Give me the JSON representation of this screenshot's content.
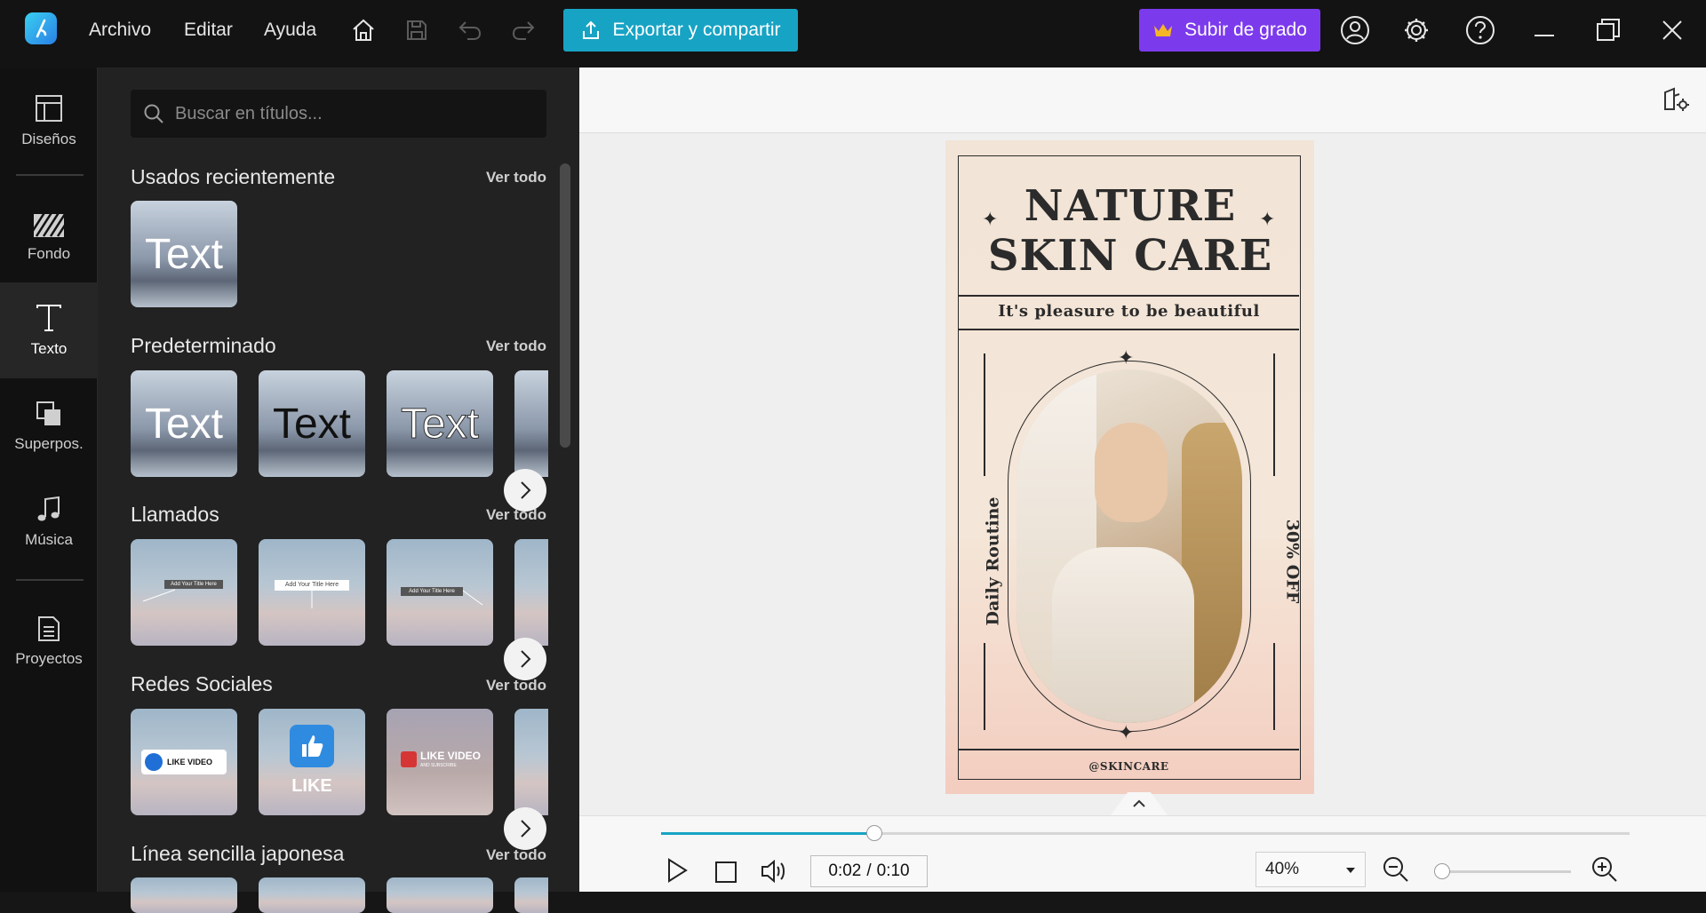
{
  "menu": [
    "Archivo",
    "Editar",
    "Ayuda"
  ],
  "toolbar": {
    "export_label": "Exportar y compartir",
    "upgrade_label": "Subir de grado"
  },
  "nav": [
    {
      "label": "Diseños",
      "icon": "layout-icon"
    },
    {
      "label": "Fondo",
      "icon": "background-icon"
    },
    {
      "label": "Texto",
      "icon": "text-icon",
      "active": true
    },
    {
      "label": "Superpos.",
      "icon": "overlay-icon"
    },
    {
      "label": "Música",
      "icon": "music-icon"
    },
    {
      "label": "Proyectos",
      "icon": "projects-icon"
    }
  ],
  "panel": {
    "search_placeholder": "Buscar en títulos...",
    "see_all": "Ver todo",
    "sections": [
      {
        "title": "Usados recientemente"
      },
      {
        "title": "Predeterminado"
      },
      {
        "title": "Llamados"
      },
      {
        "title": "Redes Sociales"
      },
      {
        "title": "Línea sencilla japonesa"
      }
    ],
    "text_sample": "Text",
    "callout_sample": "Add Your Title Here",
    "like_video": "LIKE VIDEO",
    "like": "LIKE",
    "subscribe_small": "AND SUBSCRIBE"
  },
  "poster": {
    "title_line1": "NATURE",
    "title_line2": "SKIN CARE",
    "subtitle": "It's pleasure to be beautiful",
    "left_vertical": "Daily Routine",
    "right_vertical": "30% OFF",
    "handle": "@SKINCARE"
  },
  "playback": {
    "time_current": "0:02",
    "time_separator": "/",
    "time_total": "0:10",
    "progress": 0.22,
    "zoom_value": "40%",
    "zoom_slider": 0.0
  },
  "colors": {
    "accent": "#17a3c4",
    "upgrade": "#7c3aed",
    "dark_bg": "#131313"
  }
}
